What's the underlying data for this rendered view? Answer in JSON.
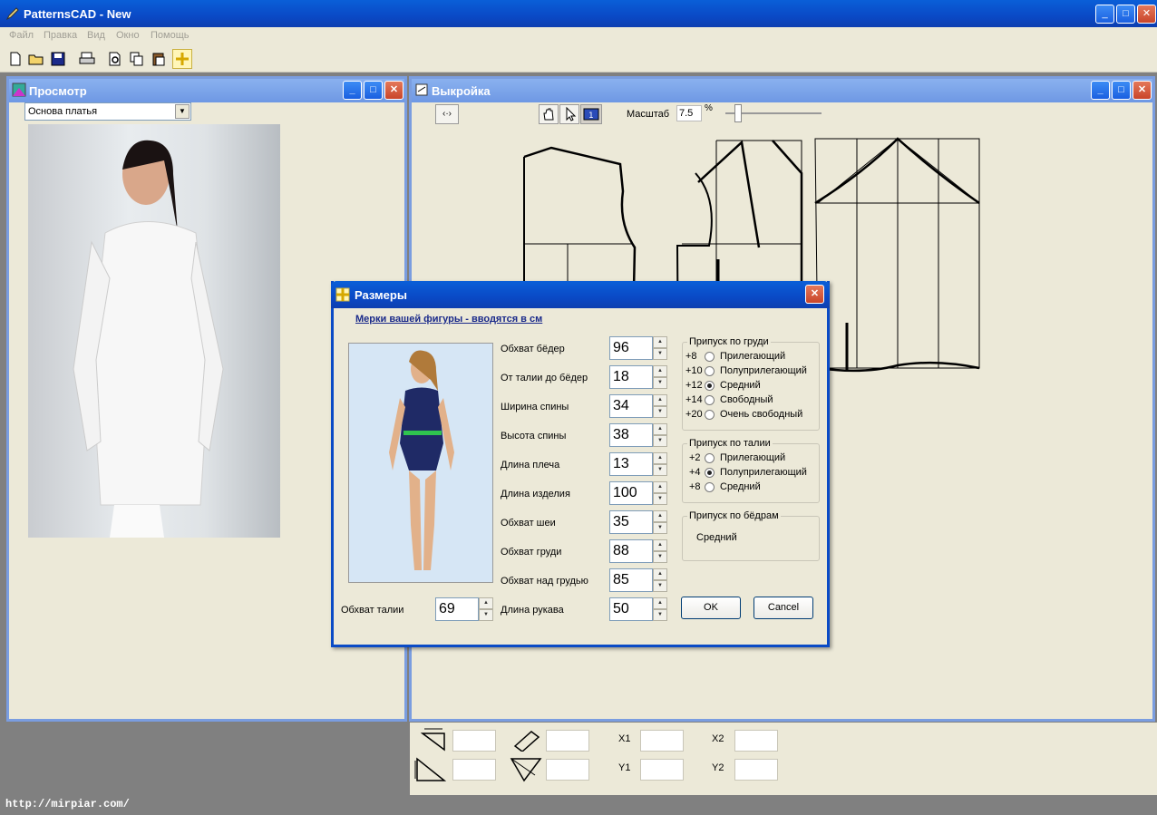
{
  "app": {
    "title": "PatternsCAD - New"
  },
  "menu": [
    "Файл",
    "Правка",
    "Вид",
    "Окно",
    "Помощь"
  ],
  "toolbar": [
    "new-file-icon",
    "open-folder-icon",
    "save-icon",
    "print-icon",
    "print-preview-icon",
    "copy-icon",
    "paste-icon",
    "grid-icon"
  ],
  "preview": {
    "title": "Просмотр",
    "select_value": "Основа платья"
  },
  "pattern": {
    "title": "Выкройка",
    "scale_label": "Масштаб",
    "scale_value": "7.5",
    "scale_unit": "%"
  },
  "dialog": {
    "title": "Размеры",
    "heading": "Мерки вашей фигуры - вводятся в см",
    "waist_label": "Обхват талии",
    "waist_value": "69",
    "fields": [
      {
        "label": "Обхват бёдер",
        "value": "96"
      },
      {
        "label": "От талии до бёдер",
        "value": "18"
      },
      {
        "label": "Ширина спины",
        "value": "34"
      },
      {
        "label": "Высота спины",
        "value": "38"
      },
      {
        "label": "Длина плеча",
        "value": "13"
      },
      {
        "label": "Длина изделия",
        "value": "100"
      },
      {
        "label": "Обхват шеи",
        "value": "35"
      },
      {
        "label": "Обхват груди",
        "value": "88"
      },
      {
        "label": "Обхват над грудью",
        "value": "85"
      },
      {
        "label": "Длина рукава",
        "value": "50"
      }
    ],
    "chest_group": {
      "label": "Припуск по груди",
      "options": [
        {
          "value": "+8",
          "name": "Прилегающий",
          "selected": false
        },
        {
          "value": "+10",
          "name": "Полуприлегающий",
          "selected": false
        },
        {
          "value": "+12",
          "name": "Средний",
          "selected": true
        },
        {
          "value": "+14",
          "name": "Свободный",
          "selected": false
        },
        {
          "value": "+20",
          "name": "Очень свободный",
          "selected": false
        }
      ]
    },
    "waist_group": {
      "label": "Припуск по талии",
      "options": [
        {
          "value": "+2",
          "name": "Прилегающий",
          "selected": false
        },
        {
          "value": "+4",
          "name": "Полуприлегающий",
          "selected": true
        },
        {
          "value": "+8",
          "name": "Средний",
          "selected": false
        }
      ]
    },
    "hips_group": {
      "label": "Припуск по бёдрам",
      "value": "Средний"
    },
    "ok_label": "OK",
    "cancel_label": "Cancel"
  },
  "coords": {
    "x1": "X1",
    "x2": "X2",
    "y1": "Y1",
    "y2": "Y2"
  },
  "status_url": "http://mirpiar.com/"
}
